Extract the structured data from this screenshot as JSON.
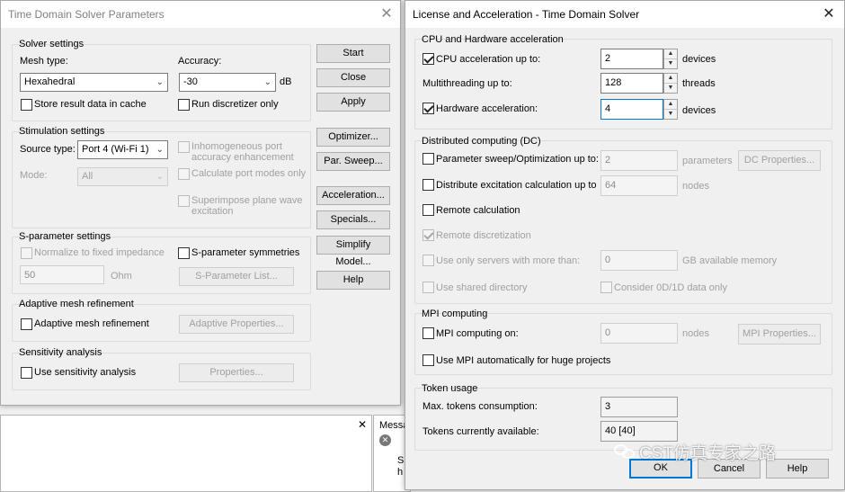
{
  "background": {
    "close_glyph": "✕",
    "messages_label": "Messa",
    "side_snippets": [
      "S",
      "h",
      "S",
      "h"
    ]
  },
  "solver": {
    "title": "Time Domain Solver Parameters",
    "solver_settings": {
      "group": "Solver settings",
      "mesh_type_label": "Mesh type:",
      "mesh_type_value": "Hexahedral",
      "accuracy_label": "Accuracy:",
      "accuracy_value": "-30",
      "accuracy_unit": "dB",
      "store_result_label": "Store result data in cache",
      "store_result_checked": false,
      "run_discretizer_label": "Run discretizer only",
      "run_discretizer_checked": false
    },
    "stimulation": {
      "group": "Stimulation settings",
      "source_type_label": "Source type:",
      "source_type_value": "Port 4 (Wi-Fi 1)",
      "mode_label": "Mode:",
      "mode_value": "All",
      "inhomogeneous_label_1": "Inhomogeneous port",
      "inhomogeneous_label_2": "accuracy enhancement",
      "calc_port_modes_label": "Calculate port modes only",
      "superimpose_label_1": "Superimpose plane wave",
      "superimpose_label_2": "excitation"
    },
    "sparam": {
      "group": "S-parameter settings",
      "normalize_label": "Normalize to fixed impedance",
      "impedance_value": "50",
      "impedance_unit": "Ohm",
      "symmetries_label": "S-parameter symmetries",
      "list_button": "S-Parameter List..."
    },
    "adaptive": {
      "group": "Adaptive mesh refinement",
      "checkbox_label": "Adaptive mesh refinement",
      "properties_button": "Adaptive Properties..."
    },
    "sensitivity": {
      "group": "Sensitivity analysis",
      "checkbox_label": "Use sensitivity analysis",
      "properties_button": "Properties..."
    },
    "buttons": {
      "start": "Start",
      "close": "Close",
      "apply": "Apply",
      "optimizer": "Optimizer...",
      "par_sweep": "Par. Sweep...",
      "acceleration": "Acceleration...",
      "specials": "Specials...",
      "simplify_model": "Simplify Model...",
      "help": "Help"
    }
  },
  "license": {
    "title": "License and Acceleration - Time Domain Solver",
    "cpu": {
      "group": "CPU and Hardware acceleration",
      "cpu_accel_label": "CPU acceleration up to:",
      "cpu_accel_checked": true,
      "cpu_accel_value": "2",
      "cpu_accel_unit": "devices",
      "multithreading_label": "Multithreading up to:",
      "multithreading_value": "128",
      "multithreading_unit": "threads",
      "hw_accel_label": "Hardware acceleration:",
      "hw_accel_checked": true,
      "hw_accel_value": "4",
      "hw_accel_unit": "devices"
    },
    "dc": {
      "group": "Distributed computing (DC)",
      "param_sweep_label": "Parameter sweep/Optimization up to:",
      "param_sweep_value": "2",
      "param_sweep_unit": "parameters",
      "dc_properties_button": "DC Properties...",
      "distribute_label": "Distribute excitation calculation up to",
      "distribute_value": "64",
      "distribute_unit": "nodes",
      "remote_calc_label": "Remote calculation",
      "remote_disc_label": "Remote discretization",
      "only_servers_label": "Use only servers with more than:",
      "only_servers_value": "0",
      "only_servers_unit": "GB available memory",
      "shared_dir_label": "Use shared directory",
      "consider_label": "Consider 0D/1D data only"
    },
    "mpi": {
      "group": "MPI computing",
      "mpi_on_label": "MPI computing on:",
      "mpi_on_value": "0",
      "mpi_on_unit": "nodes",
      "mpi_properties_button": "MPI Properties...",
      "mpi_auto_label": "Use MPI automatically for huge projects"
    },
    "token": {
      "group": "Token usage",
      "max_label": "Max. tokens consumption:",
      "max_value": "3",
      "avail_label": "Tokens currently available:",
      "avail_value": "40 [40]"
    },
    "buttons": {
      "ok": "OK",
      "cancel": "Cancel",
      "help": "Help"
    }
  },
  "watermark": {
    "text": "CST仿真专家之路"
  }
}
